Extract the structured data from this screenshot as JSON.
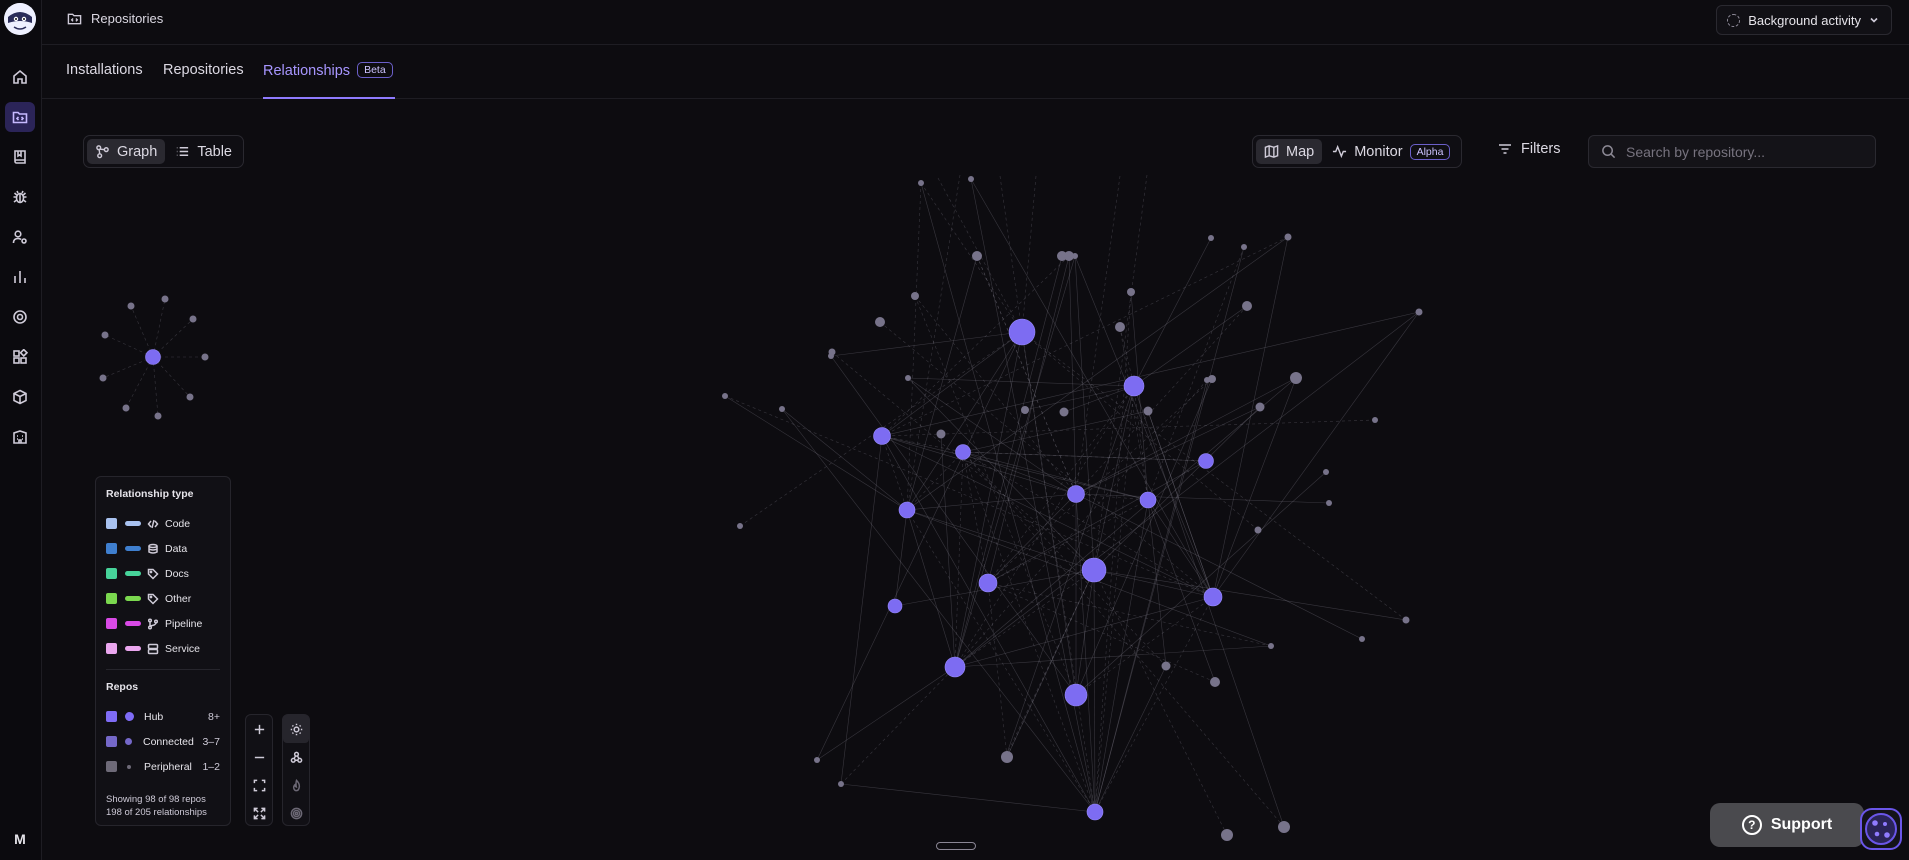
{
  "topbar": {
    "breadcrumb": "Repositories",
    "background_activity": "Background activity"
  },
  "tabs": [
    {
      "label": "Installations"
    },
    {
      "label": "Repositories"
    },
    {
      "label": "Relationships",
      "badge": "Beta",
      "active": true
    }
  ],
  "view_toggle": {
    "graph": "Graph",
    "table": "Table",
    "active": "Graph"
  },
  "mode_toggle": {
    "map": "Map",
    "monitor": "Monitor",
    "monitor_badge": "Alpha",
    "active": "Map"
  },
  "filters_label": "Filters",
  "search": {
    "placeholder": "Search by repository...",
    "value": ""
  },
  "legend": {
    "relationship_title": "Relationship type",
    "relationship_types": [
      {
        "label": "Code",
        "color": "#a9c2f0",
        "icon": "code-icon"
      },
      {
        "label": "Data",
        "color": "#3f7fcf",
        "icon": "database-icon"
      },
      {
        "label": "Docs",
        "color": "#47d39a",
        "icon": "tag-icon"
      },
      {
        "label": "Other",
        "color": "#7bd84f",
        "icon": "tag-icon"
      },
      {
        "label": "Pipeline",
        "color": "#d94ae6",
        "icon": "branch-icon"
      },
      {
        "label": "Service",
        "color": "#eaa6ee",
        "icon": "server-icon"
      }
    ],
    "repos_title": "Repos",
    "repos": [
      {
        "label": "Hub",
        "range": "8+",
        "color": "#7f6cf6"
      },
      {
        "label": "Connected",
        "range": "3–7",
        "color": "#7568c9"
      },
      {
        "label": "Peripheral",
        "range": "1–2",
        "color": "#6e6a78"
      }
    ],
    "showing_repos": "Showing 98 of 98 repos",
    "showing_relationships": "198 of 205 relationships"
  },
  "support_label": "Support",
  "user_initial": "M",
  "colors": {
    "accent": "#8f7bff",
    "node_hub": "#7d6cf2",
    "node_small": "#77738a"
  }
}
